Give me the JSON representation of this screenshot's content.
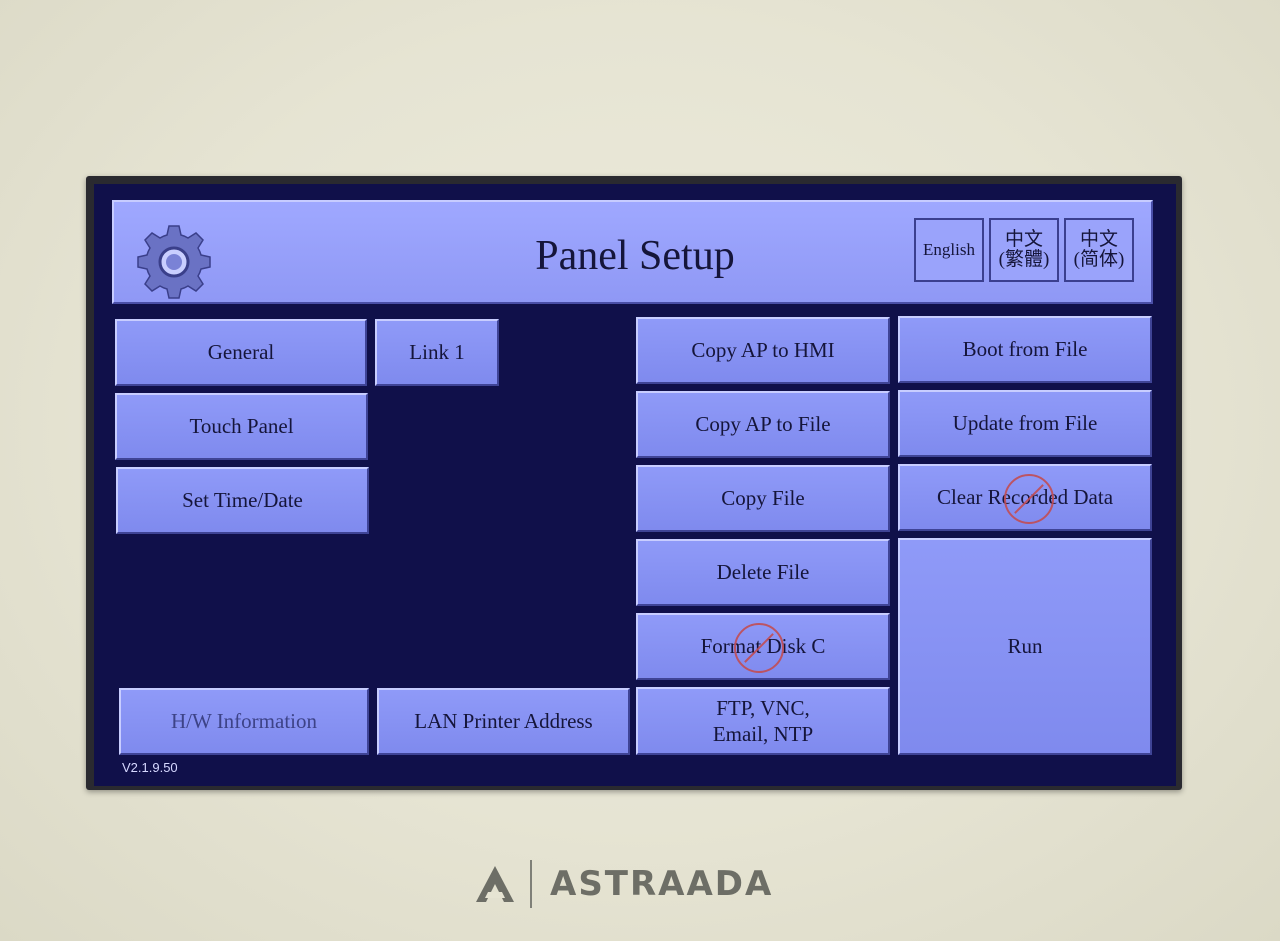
{
  "header": {
    "title": "Panel Setup",
    "languages": {
      "english": "English",
      "traditional_line1": "中文",
      "traditional_line2": "(繁體)",
      "simplified_line1": "中文",
      "simplified_line2": "(简体)"
    }
  },
  "left_buttons": {
    "general": "General",
    "link1": "Link 1",
    "touch_panel": "Touch Panel",
    "set_time_date": "Set Time/Date",
    "hw_information": "H/W Information",
    "lan_printer": "LAN Printer Address"
  },
  "right_buttons": {
    "copy_ap_hmi": "Copy AP to HMI",
    "boot_from_file": "Boot from File",
    "copy_ap_file": "Copy AP to File",
    "update_from_file": "Update from File",
    "copy_file": "Copy File",
    "clear_recorded": "Clear Recorded Data",
    "delete_file": "Delete File",
    "run": "Run",
    "format_disk": "Format Disk C",
    "ftp_line1": "FTP, VNC,",
    "ftp_line2": "Email, NTP"
  },
  "version": "V2.1.9.50",
  "brand": "ASTRAADA",
  "colors": {
    "screen_bg": "#10104a",
    "button": "#8f9af8",
    "text": "#15153a",
    "disabled_marker": "#c24d54"
  }
}
